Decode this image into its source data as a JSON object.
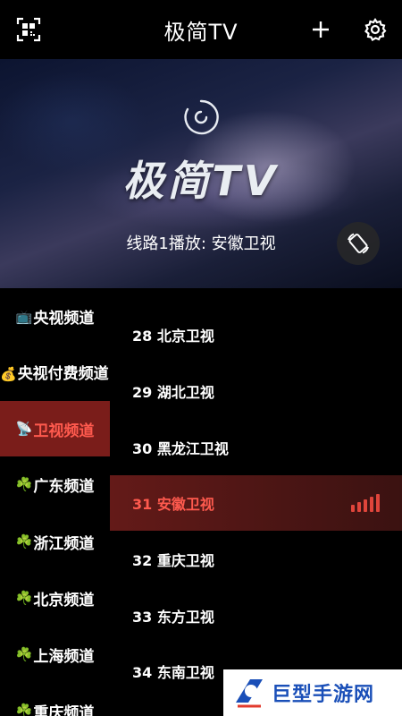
{
  "header": {
    "title": "极简TV",
    "icons": [
      "qr-scan-icon",
      "plus-icon",
      "gear-icon"
    ]
  },
  "player": {
    "brand": "极简TV",
    "route_text": "线路1播放: 安徽卫视",
    "rotate_icon": "screen-rotate-icon"
  },
  "categories": [
    {
      "icon": "📺",
      "label": "央视频道",
      "active": false
    },
    {
      "icon": "💰",
      "label": "央视付费频道",
      "active": false
    },
    {
      "icon": "📡",
      "label": "卫视频道",
      "active": true
    },
    {
      "icon": "☘️",
      "label": "广东频道",
      "active": false
    },
    {
      "icon": "☘️",
      "label": "浙江频道",
      "active": false
    },
    {
      "icon": "☘️",
      "label": "北京频道",
      "active": false
    },
    {
      "icon": "☘️",
      "label": "上海频道",
      "active": false
    },
    {
      "icon": "☘️",
      "label": "重庆频道",
      "active": false
    }
  ],
  "channels": [
    {
      "label": "28 北京卫视",
      "active": false
    },
    {
      "label": "29 湖北卫视",
      "active": false
    },
    {
      "label": "30 黑龙江卫视",
      "active": false
    },
    {
      "label": "31 安徽卫视",
      "active": true
    },
    {
      "label": "32 重庆卫视",
      "active": false
    },
    {
      "label": "33 东方卫视",
      "active": false
    },
    {
      "label": "34 东南卫视",
      "active": false
    }
  ],
  "watermark": {
    "text": "巨型手游网"
  },
  "colors": {
    "accent": "#ff5a4e",
    "active_bg": "#7a1d1a",
    "bars": "#e0453b"
  }
}
